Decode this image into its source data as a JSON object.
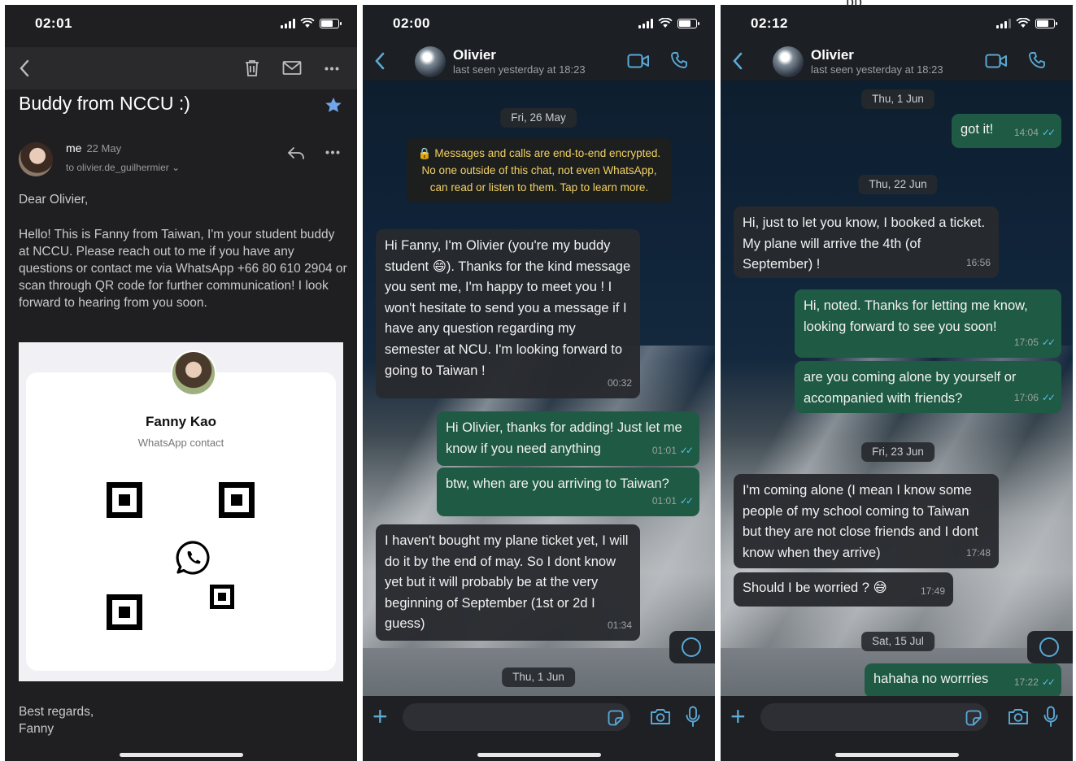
{
  "top_note": "pp",
  "email": {
    "status_time": "02:01",
    "subject": "Buddy from NCCU :)",
    "sender": "me",
    "sender_date": "22 May",
    "recipient": "to olivier.de_guilhermier ⌄",
    "greeting": "Dear Olivier,",
    "body": "Hello! This is Fanny from Taiwan, I'm your student buddy at NCCU. Please reach out to me if you have any questions or contact me via WhatsApp +66 80 610 2904 or scan through QR code for further communication! I look forward to hearing from you soon.",
    "card_name": "Fanny Kao",
    "card_sub": "WhatsApp contact",
    "signoff_1": "Best regards,",
    "signoff_2": "Fanny",
    "icons": [
      "back-icon",
      "trash-icon",
      "mail-icon",
      "more-icon",
      "star-icon",
      "reply-icon",
      "whatsapp-icon"
    ]
  },
  "chat1": {
    "status_time": "02:00",
    "contact_name": "Olivier",
    "last_seen": "last seen yesterday at 18:23",
    "date_1": "Fri, 26 May",
    "encryption": "🔒 Messages and calls are end-to-end encrypted. No one outside of this chat, not even WhatsApp, can read or listen to them. Tap to learn more.",
    "messages": [
      {
        "dir": "in",
        "text": "Hi Fanny, I'm Olivier (you're my buddy student 😄). Thanks for the kind message you sent me, I'm happy to meet you ! I won't hesitate to send you a message if I have any question regarding my semester at NCU. I'm looking forward to going to Taiwan !",
        "time": "00:32"
      },
      {
        "dir": "out",
        "text": "Hi Olivier, thanks for adding! Just let me know if you need anything",
        "time": "01:01"
      },
      {
        "dir": "out",
        "text": "btw, when are you arriving to Taiwan?",
        "time": "01:01"
      },
      {
        "dir": "in",
        "text": "I haven't bought my plane ticket yet, I will do it by the end of may. So I dont know yet but it will probably be at the very beginning of September (1st or 2d I guess)",
        "time": "01:34"
      }
    ],
    "date_2": "Thu, 1 Jun"
  },
  "chat2": {
    "status_time": "02:12",
    "contact_name": "Olivier",
    "last_seen": "last seen yesterday at 18:23",
    "date_1": "Thu, 1 Jun",
    "date_2": "Thu, 22 Jun",
    "date_3": "Fri, 23 Jun",
    "date_4": "Sat, 15 Jul",
    "messages": [
      {
        "dir": "out",
        "text": "got it!",
        "time": "14:04"
      },
      {
        "dir": "in",
        "text": "Hi, just to let you know, I booked a ticket. My plane will arrive the 4th (of September) !",
        "time": "16:56"
      },
      {
        "dir": "out",
        "text": "Hi, noted. Thanks for letting me know, looking forward to see you soon!",
        "time": "17:05"
      },
      {
        "dir": "out",
        "text": "are you coming alone by yourself or accompanied with friends?",
        "time": "17:06"
      },
      {
        "dir": "in",
        "text": "I'm coming alone (I mean I know some people of my school coming to Taiwan but they are not close friends and I dont know when they arrive)",
        "time": "17:48"
      },
      {
        "dir": "in",
        "text": "Should I be worried ? 😅",
        "time": "17:49"
      },
      {
        "dir": "out",
        "text": "hahaha no worrries",
        "time": "17:22"
      }
    ]
  },
  "colors": {
    "accent_blue": "#5aa9d6",
    "outgoing_bubble": "#1f5a45",
    "incoming_bubble": "#282a2e",
    "encryption_text": "#f2d263"
  }
}
